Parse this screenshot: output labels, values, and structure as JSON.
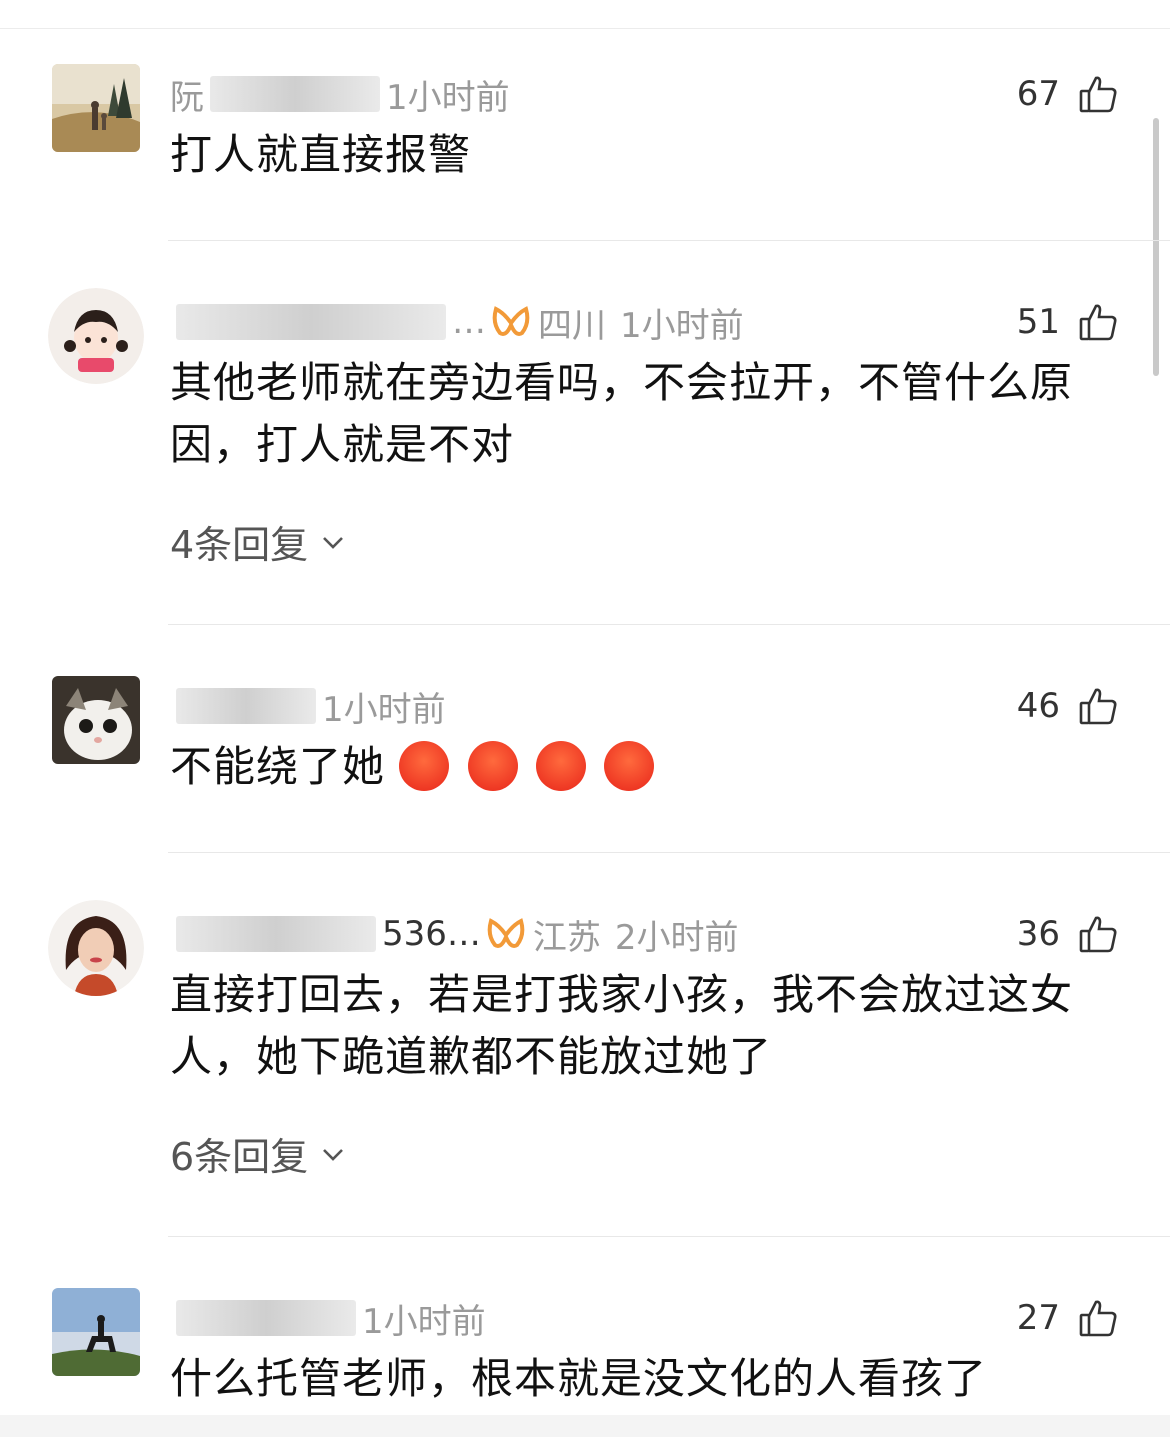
{
  "comments": [
    {
      "name": "阮",
      "location": "",
      "time": "1小时前",
      "likes": "67",
      "text": "打人就直接报警",
      "replies": ""
    },
    {
      "name": "…",
      "location": "四川",
      "time": "1小时前",
      "likes": "51",
      "text": "其他老师就在旁边看吗，不会拉开，不管什么原因，打人就是不对",
      "replies": "4条回复"
    },
    {
      "name": "",
      "location": "",
      "time": "1小时前",
      "likes": "46",
      "text": "不能绕了她",
      "replies": ""
    },
    {
      "name": "536…",
      "location": "江苏",
      "time": "2小时前",
      "likes": "36",
      "text": "直接打回去，若是打我家小孩，我不会放过这女人，她下跪道歉都不能放过她了",
      "replies": "6条回复"
    },
    {
      "name": "",
      "location": "",
      "time": "1小时前",
      "likes": "27",
      "text": "什么托管老师，根本就是没文化的人看孩了",
      "replies": ""
    }
  ],
  "colors": {
    "meta": "#9a9a9a",
    "vip": "#f29a38",
    "emoji": "#e8251a"
  }
}
